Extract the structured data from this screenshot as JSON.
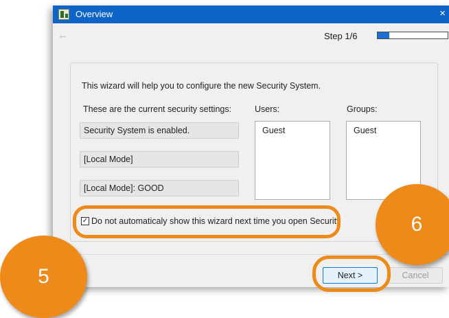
{
  "window": {
    "title": "Overview",
    "close_glyph": "×",
    "app_icon": "app-icon"
  },
  "toolbar": {
    "back_glyph": "←",
    "step_label": "Step 1/6",
    "progress": 0.17
  },
  "content": {
    "intro": "This wizard will help you to configure the new Security System.",
    "settings_heading": "These are the current security settings:",
    "settings": [
      "Security System is enabled.",
      "[Local Mode]",
      "[Local Mode]: GOOD"
    ],
    "users_label": "Users:",
    "users": [
      "Guest"
    ],
    "groups_label": "Groups:",
    "groups": [
      "Guest"
    ],
    "checkbox_label": "Do not automaticaly show this wizard next time you open Security",
    "checkbox_checked": true,
    "checkbox_glyph": "✓"
  },
  "buttons": {
    "next": "Next >",
    "cancel": "Cancel"
  },
  "annotations": {
    "badge_left": "5",
    "badge_right": "6",
    "color": "#ed8a1a"
  },
  "colors": {
    "titlebar": "#0f64c8",
    "progress_fill": "#1a6fd1"
  }
}
